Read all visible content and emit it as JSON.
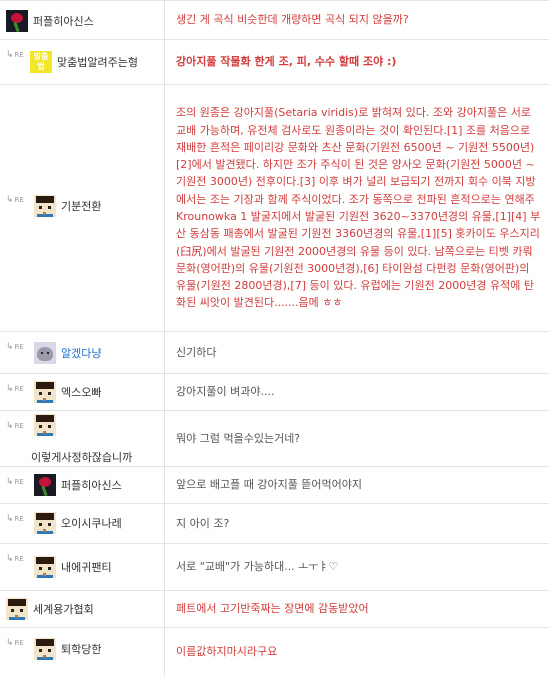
{
  "reply_marker": "RE",
  "comments": [
    {
      "author": "퍼플히아신스",
      "avatar": "rose-icon",
      "reply": false,
      "text": "생긴 게 곡식 비슷한데 개량하면 곡식 되지 않을까?",
      "style": "red"
    },
    {
      "author": "맞춤법알려주는형",
      "avatar": "yellow-badge-icon",
      "avatar_text": "맞춤법",
      "reply": true,
      "text": "강아지풀 작물화 한게 조, 피, 수수 할때 조야 :)",
      "style": "red-bold"
    },
    {
      "author": "기분전환",
      "avatar": "pixel-boy-icon",
      "reply": true,
      "text": "조의 원종은 강아지풀(Setaria viridis)로 밝혀져 있다. 조와 강아지풀은 서로 교배 가능하며, 유전체 검사로도 원종이라는 것이 확인된다.[1] 조를 처음으로 재배한 흔적은 페이리강 문화와 츠산 문화(기원전 6500년 ~ 기원전 5500년)[2]에서 발견됐다. 하지만 조가 주식이 된 것은 양사오 문화(기원전 5000년 ~ 기원전 3000년) 전후이다.[3] 이후 벼가 널리 보급되기 전까지 회수 이북 지방에서는 조는 기장과 함께 주식이었다. 조가 동쪽으로 전파된 흔적으로는 연해주 Krounowka 1 발굴지에서 발굴된 기원전 3620~3370년경의 유물,[1][4] 부산 동삼동 패총에서 발굴된 기원전 3360년경의 유물,[1][5] 홋카이도 우스지리(臼尻)에서 발굴된 기원전 2000년경의 유물 등이 있다. 남쪽으로는 티벳 카뤄 문화(영어판)의 유물(기원전 3000년경),[6] 타이완섬 다펀컹 문화(영어판)의 유물(기원전 2800년경),[7] 등이 있다. 유럽에는 기원전 2000년경 유적에 탄화된 씨앗이 발견된다.......음메 ㅎㅎ",
      "style": "red"
    },
    {
      "author": "알겠다냥",
      "avatar": "cat-icon",
      "reply": true,
      "nick_color": "blue",
      "text": "신기하다",
      "style": "gray"
    },
    {
      "author": "엑스오빠",
      "avatar": "pixel-boy-icon",
      "reply": true,
      "text": "강아지풀이 벼과야....",
      "style": "gray"
    },
    {
      "author": "이렇게사정하잖습니까",
      "avatar": "pixel-boy-icon",
      "reply": true,
      "text": "뭐야 그럼 먹을수있는거네?",
      "style": "gray"
    },
    {
      "author": "퍼플히아신스",
      "avatar": "rose-icon",
      "reply": true,
      "text": "앞으로 배고플 때 강아지풀 뜯어먹어야지",
      "style": "gray"
    },
    {
      "author": "오이시쿠나레",
      "avatar": "pixel-boy-icon",
      "reply": true,
      "text": "지 아이 조?",
      "style": "gray"
    },
    {
      "author": "내에귀팬티",
      "avatar": "pixel-boy-icon",
      "reply": true,
      "text": "서로 \"교배\"가 가능하대... ㅗㅜㅑ♡",
      "style": "gray"
    },
    {
      "author": "세계용가협회",
      "avatar": "pixel-boy-icon",
      "reply": false,
      "text": "페트에서 고기반죽짜는 장면에 감동받았어",
      "style": "red"
    },
    {
      "author": "퇴학당한",
      "avatar": "pixel-boy-icon",
      "reply": true,
      "text": "이름값하지마시라구요",
      "style": "red"
    }
  ]
}
